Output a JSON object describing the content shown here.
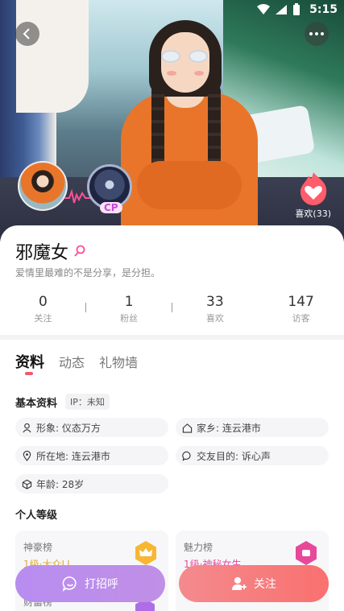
{
  "status": {
    "time": "5:15"
  },
  "hero": {
    "like_count": "喜欢(33)",
    "cp_label": "CP"
  },
  "profile": {
    "name": "邪魔女",
    "bio": "爱情里最难的不是分享，是分担。"
  },
  "stats": [
    {
      "value": "0",
      "label": "关注"
    },
    {
      "value": "1",
      "label": "粉丝"
    },
    {
      "value": "33",
      "label": "喜欢"
    },
    {
      "value": "147",
      "label": "访客"
    }
  ],
  "tabs": [
    {
      "label": "资料"
    },
    {
      "label": "动态"
    },
    {
      "label": "礼物墙"
    }
  ],
  "basic": {
    "title": "基本资料",
    "ip": "IP：未知",
    "items": [
      {
        "label": "形象: 仪态万方"
      },
      {
        "label": "家乡: 连云港市"
      },
      {
        "label": "所在地: 连云港市"
      },
      {
        "label": "交友目的: 诉心声"
      },
      {
        "label": "年龄: 28岁"
      }
    ]
  },
  "level": {
    "title": "个人等级",
    "cards": [
      {
        "title": "神豪榜",
        "value": "1级·大众LI",
        "sub": "财富榜"
      },
      {
        "title": "魅力榜",
        "value": "1级·神秘女生",
        "sub": ""
      }
    ]
  },
  "actions": {
    "greet": "打招呼",
    "follow": "关注"
  },
  "colors": {
    "accent": "#f0586e",
    "greet": "#b88df0",
    "follow": "#f9716f"
  }
}
